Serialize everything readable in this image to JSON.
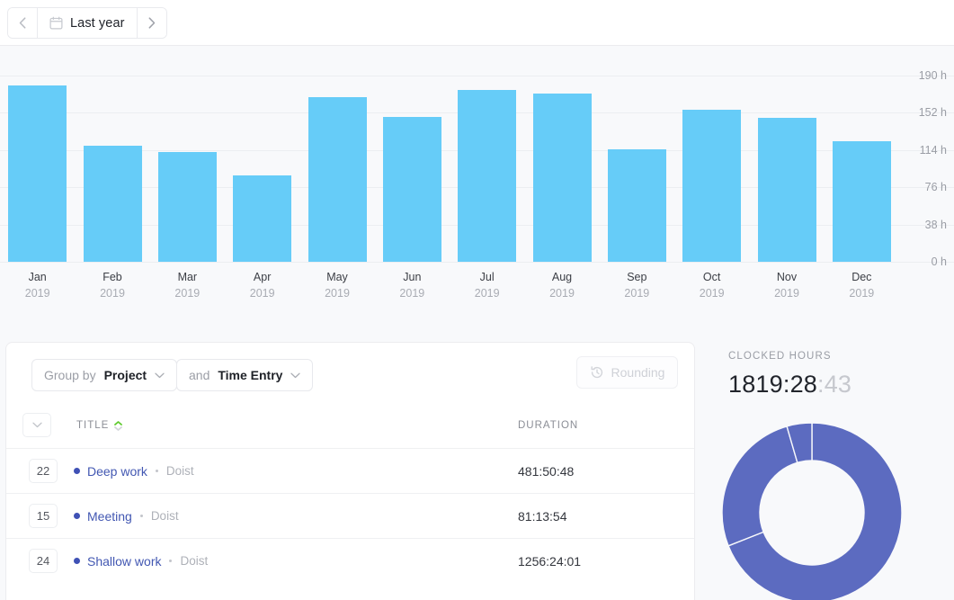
{
  "toolbar": {
    "prev_label": "‹",
    "next_label": "›",
    "period_label": "Last year",
    "calendar_icon": "calendar-icon",
    "prev_icon": "chevron-left-icon",
    "next_icon": "chevron-right-icon"
  },
  "chart_data": {
    "type": "bar",
    "title": "",
    "xlabel": "",
    "ylabel": "",
    "ylim": [
      0,
      190
    ],
    "grid": true,
    "ytick_labels": [
      "190 h",
      "152 h",
      "114 h",
      "76 h",
      "38 h",
      "0 h"
    ],
    "ytick_values": [
      190,
      152,
      114,
      76,
      38,
      0
    ],
    "bar_color": "#66ccf8",
    "categories": [
      "Jan",
      "Feb",
      "Mar",
      "Apr",
      "May",
      "Jun",
      "Jul",
      "Aug",
      "Sep",
      "Oct",
      "Nov",
      "Dec"
    ],
    "category_years": [
      "2019",
      "2019",
      "2019",
      "2019",
      "2019",
      "2019",
      "2019",
      "2019",
      "2019",
      "2019",
      "2019",
      "2019"
    ],
    "values": [
      180,
      118,
      112,
      88,
      168,
      148,
      175,
      172,
      115,
      155,
      147,
      123
    ]
  },
  "controls": {
    "group_by_prefix": "Group by",
    "group_by_value": "Project",
    "and_prefix": "and",
    "and_value": "Time Entry",
    "rounding_label": "Rounding",
    "rounding_icon": "history-clock-icon",
    "chevron_icon": "chevron-down-icon"
  },
  "table": {
    "collapse_icon": "chevron-down-icon",
    "columns": {
      "title": "TITLE",
      "duration": "DURATION"
    },
    "sort": {
      "column": "TITLE",
      "direction": "asc",
      "active_color": "#5fca2d"
    },
    "rows": [
      {
        "count": "22",
        "title": "Deep work",
        "project": "Doist",
        "duration": "481:50:48",
        "dot_color": "#3f51b5"
      },
      {
        "count": "15",
        "title": "Meeting",
        "project": "Doist",
        "duration": "81:13:54",
        "dot_color": "#3f51b5"
      },
      {
        "count": "24",
        "title": "Shallow work",
        "project": "Doist",
        "duration": "1256:24:01",
        "dot_color": "#3f51b5"
      }
    ]
  },
  "summary": {
    "label": "CLOCKED HOURS",
    "value_main": "1819:28",
    "value_fraction": ":43",
    "donut": {
      "type": "pie",
      "color": "#5c6bc0",
      "slices": [
        {
          "name": "Shallow work",
          "value": 1256.4,
          "percent": 69.0
        },
        {
          "name": "Deep work",
          "value": 481.85,
          "percent": 26.5
        },
        {
          "name": "Meeting",
          "value": 81.23,
          "percent": 4.5
        }
      ]
    }
  }
}
